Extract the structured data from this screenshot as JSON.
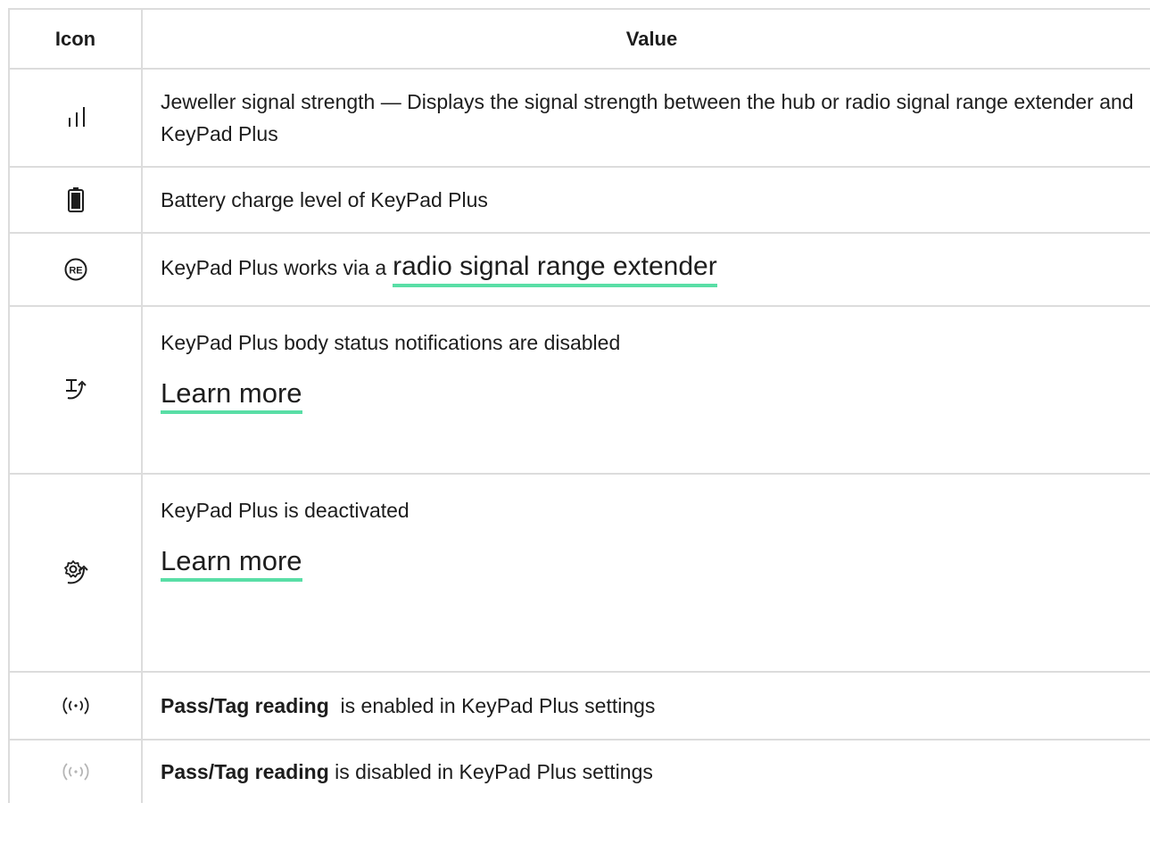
{
  "table": {
    "header": {
      "icon": "Icon",
      "value": "Value"
    },
    "rows": [
      {
        "icon": "signal-strength-icon",
        "text": "Jeweller signal strength — Displays the signal strength between the hub or radio signal range extender and KeyPad Plus"
      },
      {
        "icon": "battery-icon",
        "text": "Battery charge level of KeyPad Plus"
      },
      {
        "icon": "range-extender-icon",
        "text": "KeyPad Plus works via a",
        "link": "radio signal range extender"
      },
      {
        "icon": "body-status-icon",
        "text": "KeyPad Plus body status notifications are disabled",
        "link": "Learn more"
      },
      {
        "icon": "deactivated-gear-icon",
        "text": "KeyPad Plus is deactivated",
        "link": "Learn more"
      },
      {
        "icon": "pass-tag-enabled-icon",
        "bold": "Pass/Tag reading",
        "text": "  is enabled in KeyPad Plus settings"
      },
      {
        "icon": "pass-tag-disabled-icon",
        "bold": "Pass/Tag reading",
        "text": " is disabled in KeyPad Plus settings"
      }
    ]
  },
  "colors": {
    "border": "#dcdcdc",
    "link_underline": "#59dea6",
    "text": "#1d1d1d",
    "icon_disabled": "#b5b5b5"
  }
}
